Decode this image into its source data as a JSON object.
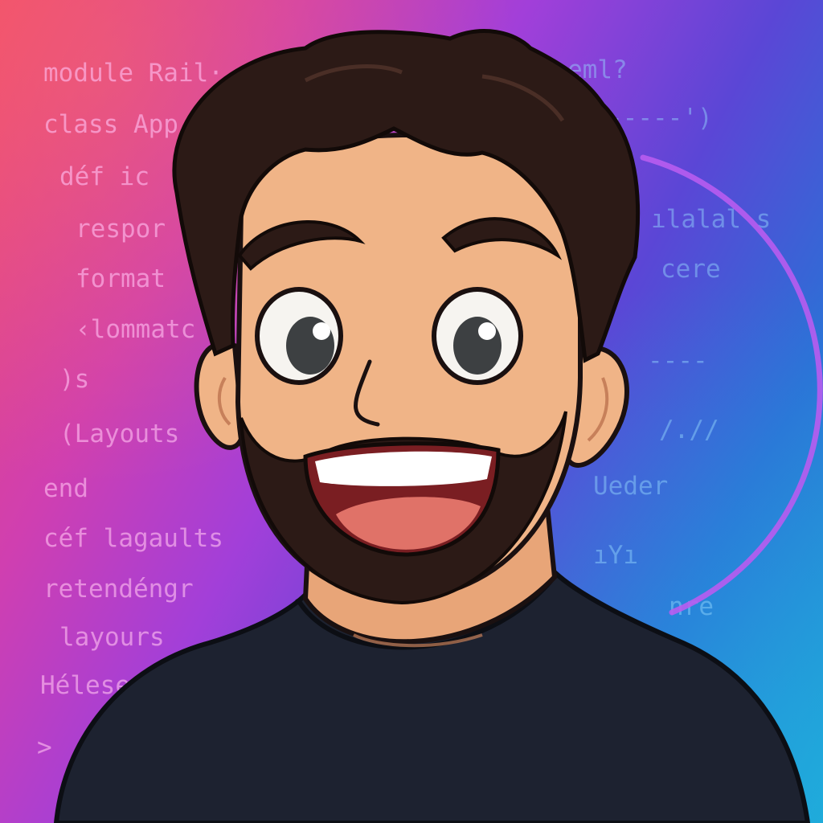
{
  "code_left": [
    "module Rail·",
    "class App",
    "déf ic",
    "respor",
    "format",
    "‹lommatc",
    ")s",
    "(Layouts",
    "end",
    "céf lagaults",
    "retendéngr",
    "layours",
    "Hélese",
    ">"
  ],
  "code_right": [
    "eml?",
    "-----')",
    "ılalal s",
    "cere",
    "----",
    "/.//",
    "Ueder",
    "ıYı",
    "nre"
  ],
  "colors": {
    "gradient_start": "#ef4a72",
    "gradient_mid": "#a23fd9",
    "gradient_end": "#1fa0d6",
    "hair": "#2c1a16",
    "skin": "#f0b487",
    "shirt": "#1d2230",
    "arc": "#b85cf0"
  }
}
